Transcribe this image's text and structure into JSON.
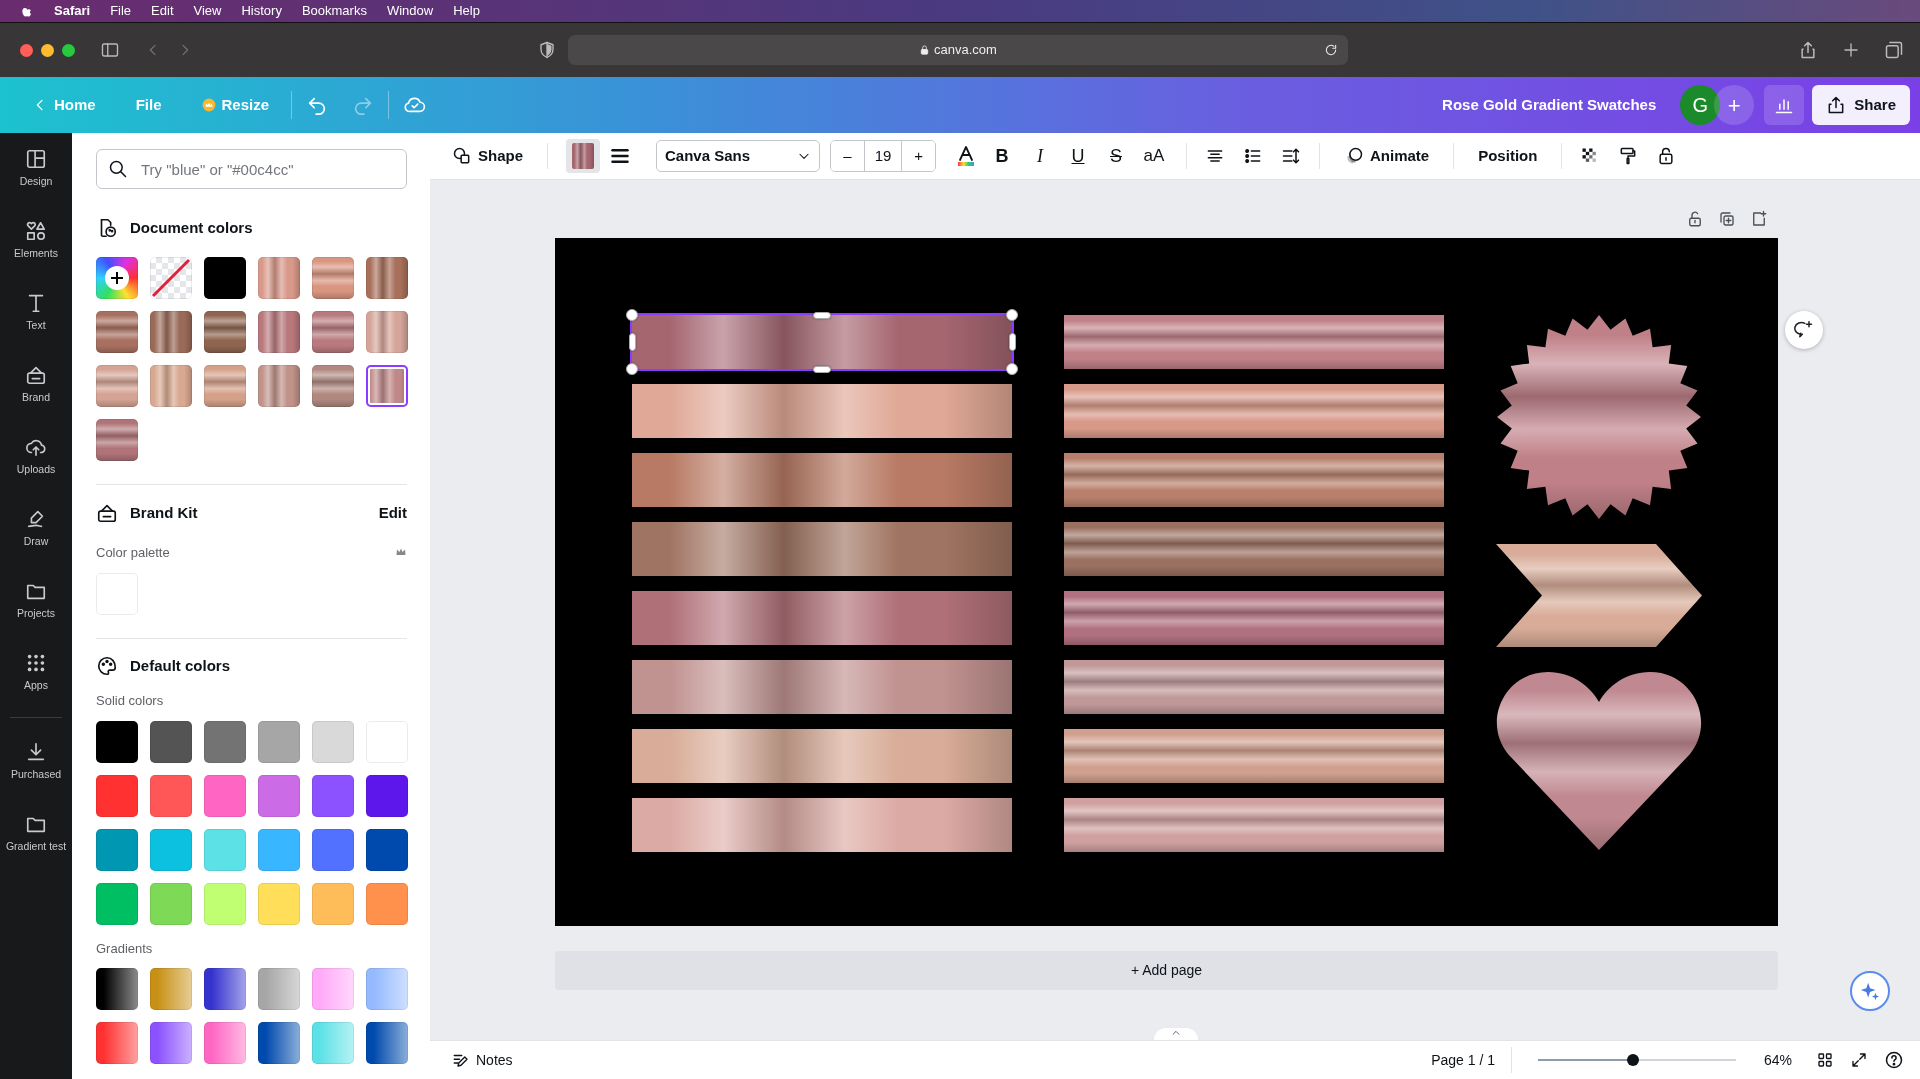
{
  "menubar": {
    "app": "Safari",
    "items": [
      "File",
      "Edit",
      "View",
      "History",
      "Bookmarks",
      "Window",
      "Help"
    ]
  },
  "browser": {
    "url": "canva.com"
  },
  "header": {
    "nav": [
      "Home",
      "File",
      "Resize"
    ],
    "title": "Rose Gold Gradient Swatches",
    "avatar": "G",
    "invite": "+",
    "share": "Share"
  },
  "toolbar": {
    "shape": "Shape",
    "font": "Canva Sans",
    "size_minus": "–",
    "size": "19",
    "size_plus": "+",
    "format": [
      "B",
      "I",
      "U",
      "S",
      "aA"
    ],
    "animate": "Animate",
    "position": "Position"
  },
  "rail": {
    "items": [
      {
        "label": "Design"
      },
      {
        "label": "Elements"
      },
      {
        "label": "Text"
      },
      {
        "label": "Brand"
      },
      {
        "label": "Uploads"
      },
      {
        "label": "Draw"
      },
      {
        "label": "Projects"
      },
      {
        "label": "Apps"
      }
    ],
    "extra_items": [
      {
        "label": "Purchased"
      },
      {
        "label": "Gradient test"
      }
    ]
  },
  "panel": {
    "search": {
      "placeholder": "Try \"blue\" or \"#00c4cc\""
    },
    "document_colors": {
      "title": "Document colors",
      "swatches": [
        {
          "kind": "add",
          "selected": false
        },
        {
          "kind": "none",
          "selected": false
        },
        {
          "kind": "solid",
          "color": "#000000",
          "selected": false
        },
        {
          "kind": "vertical_gradient",
          "color": "#d9998a",
          "selected": false
        },
        {
          "kind": "horizontal_gradient",
          "color": "#d8957f",
          "selected": false
        },
        {
          "kind": "vertical_gradient",
          "color": "#a8705a",
          "selected": false
        },
        {
          "kind": "horizontal_gradient",
          "color": "#a87060",
          "selected": false
        },
        {
          "kind": "vertical_gradient",
          "color": "#9a6a58",
          "selected": false
        },
        {
          "kind": "horizontal_gradient",
          "color": "#8f6550",
          "selected": false
        },
        {
          "kind": "vertical_gradient",
          "color": "#b8787c",
          "selected": false
        },
        {
          "kind": "horizontal_gradient",
          "color": "#b87a7e",
          "selected": false
        },
        {
          "kind": "vertical_gradient",
          "color": "#d6a59a",
          "selected": false
        },
        {
          "kind": "horizontal_gradient",
          "color": "#d4a394",
          "selected": false
        },
        {
          "kind": "vertical_gradient",
          "color": "#d8a890",
          "selected": false
        },
        {
          "kind": "horizontal_gradient",
          "color": "#d4a088",
          "selected": false
        },
        {
          "kind": "vertical_gradient",
          "color": "#c0928a",
          "selected": false
        },
        {
          "kind": "horizontal_gradient",
          "color": "#b08880",
          "selected": false
        },
        {
          "kind": "vertical_gradient",
          "color": "#c08888",
          "selected": true
        },
        {
          "kind": "horizontal_gradient",
          "color": "#b07478",
          "selected": false
        }
      ]
    },
    "brand_kit": {
      "title": "Brand Kit",
      "action": "Edit",
      "palette_label": "Color palette",
      "palette": [
        {
          "color": "#ffffff"
        }
      ]
    },
    "default_colors": {
      "title": "Default colors",
      "solid_label": "Solid colors",
      "solid": [
        {
          "color": "#000000"
        },
        {
          "color": "#545454"
        },
        {
          "color": "#737373"
        },
        {
          "color": "#a6a6a6"
        },
        {
          "color": "#d9d9d9"
        },
        {
          "color": "#ffffff"
        },
        {
          "color": "#ff3131"
        },
        {
          "color": "#ff5757"
        },
        {
          "color": "#ff66c4"
        },
        {
          "color": "#cb6ce6"
        },
        {
          "color": "#8c52ff"
        },
        {
          "color": "#5e17eb"
        },
        {
          "color": "#0097b2"
        },
        {
          "color": "#0cc0df"
        },
        {
          "color": "#5ce1e6"
        },
        {
          "color": "#38b6ff"
        },
        {
          "color": "#5271ff"
        },
        {
          "color": "#004aad"
        },
        {
          "color": "#00bf63"
        },
        {
          "color": "#7ed957"
        },
        {
          "color": "#c1ff72"
        },
        {
          "color": "#ffde59"
        },
        {
          "color": "#ffbd59"
        },
        {
          "color": "#ff914d"
        }
      ],
      "gradients_label": "Gradients",
      "gradients": [
        {
          "color": "#000000"
        },
        {
          "color": "#c89116"
        },
        {
          "color": "#3533cd"
        },
        {
          "color": "#a6a6a6"
        },
        {
          "color": "#ffa9f9"
        },
        {
          "color": "#94b9ff"
        },
        {
          "color": "#ff3131"
        },
        {
          "color": "#8c52ff"
        },
        {
          "color": "#ff66c4"
        },
        {
          "color": "#004aad"
        },
        {
          "color": "#5ce1e6"
        },
        {
          "color": "#004aad"
        }
      ]
    }
  },
  "canvas": {
    "left_column": [
      {
        "color": "#a56670",
        "selected": true
      },
      {
        "color": "#e0a896",
        "selected": false
      },
      {
        "color": "#b87a64",
        "selected": false
      },
      {
        "color": "#a07462",
        "selected": false
      },
      {
        "color": "#b07078",
        "selected": false
      },
      {
        "color": "#c09290",
        "selected": false
      },
      {
        "color": "#d8ac98",
        "selected": false
      },
      {
        "color": "#dcaaa4",
        "selected": false
      }
    ],
    "right_column": [
      {
        "color": "#c08088",
        "selected": false
      },
      {
        "color": "#d89a88",
        "selected": false
      },
      {
        "color": "#b8806c",
        "selected": false
      },
      {
        "color": "#9a7060",
        "selected": false
      },
      {
        "color": "#b07080",
        "selected": false
      },
      {
        "color": "#c09898",
        "selected": false
      },
      {
        "color": "#d0a08e",
        "selected": false
      },
      {
        "color": "#d0a0a0",
        "selected": false
      }
    ],
    "shapes": [
      {
        "kind": "starburst",
        "color": "#c08088",
        "selected": false
      },
      {
        "kind": "chevron",
        "color": "#d8ac98",
        "selected": false
      },
      {
        "kind": "heart",
        "color": "#c08890",
        "selected": false
      }
    ]
  },
  "add_page": "+ Add page",
  "status_bar": {
    "notes": "Notes",
    "page": "Page 1 / 1",
    "zoom": {
      "level": 0.48
    },
    "zoom_reading": "64%"
  }
}
